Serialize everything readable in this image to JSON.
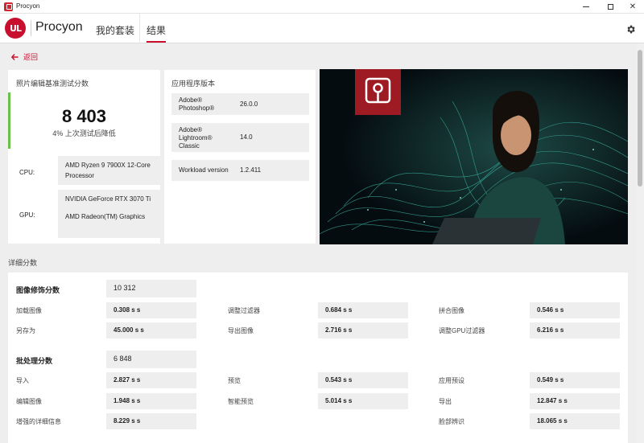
{
  "window": {
    "title": "Procyon"
  },
  "header": {
    "brand": "Procyon",
    "logo_text": "UL",
    "tabs": [
      {
        "label": "我的套装"
      },
      {
        "label": "结果"
      }
    ],
    "active_tab": "结果"
  },
  "back": {
    "label": "返回"
  },
  "score_card": {
    "title": "照片编辑基准测试分数",
    "score": "8 403",
    "comparison": "4% 上次测试后降低",
    "cpu_label": "CPU:",
    "cpu_value": "AMD Ryzen 9 7900X 12-Core Processor",
    "gpu_label": "GPU:",
    "gpu_values": [
      "NVIDIA GeForce RTX 3070 Ti",
      "AMD Radeon(TM) Graphics"
    ]
  },
  "version_card": {
    "title": "应用程序版本",
    "rows": [
      {
        "name": "Adobe® Photoshop®",
        "value": "26.0.0"
      },
      {
        "name": "Adobe® Lightroom® Classic",
        "value": "14.0"
      },
      {
        "name": "Workload version",
        "value": "1.2.411"
      }
    ]
  },
  "details": {
    "title": "详细分数",
    "sections": [
      {
        "title": "图像修饰分数",
        "score": "10 312",
        "metrics": [
          {
            "label": "加载图像",
            "value": "0.308 s s"
          },
          {
            "label": "调整过滤器",
            "value": "0.684 s s"
          },
          {
            "label": "拼合图像",
            "value": "0.546 s s"
          },
          {
            "label": "另存为",
            "value": "45.000 s s"
          },
          {
            "label": "导出图像",
            "value": "2.716 s s"
          },
          {
            "label": "调整GPU过滤器",
            "value": "6.216 s s"
          }
        ]
      },
      {
        "title": "批处理分数",
        "score": "6 848",
        "metrics": [
          {
            "label": "导入",
            "value": "2.827 s s"
          },
          {
            "label": "预览",
            "value": "0.543 s s"
          },
          {
            "label": "应用预设",
            "value": "0.549 s s"
          },
          {
            "label": "编辑图像",
            "value": "1.948 s s"
          },
          {
            "label": "智能预览",
            "value": "5.014 s s"
          },
          {
            "label": "导出",
            "value": "12.847 s s"
          },
          {
            "label": "增强的详细信息",
            "value": "8.229 s s"
          },
          {
            "label": "脸部辨识",
            "value": "18.065 s s"
          }
        ]
      }
    ]
  },
  "colors": {
    "accent": "#c8102e",
    "score_bar": "#6cc04a",
    "box_bg": "#eeeeee"
  },
  "icons": [
    "app-icon",
    "minimize-icon",
    "maximize-icon",
    "close-icon",
    "gear-icon",
    "arrow-left-icon",
    "photoshop-app-icon"
  ]
}
